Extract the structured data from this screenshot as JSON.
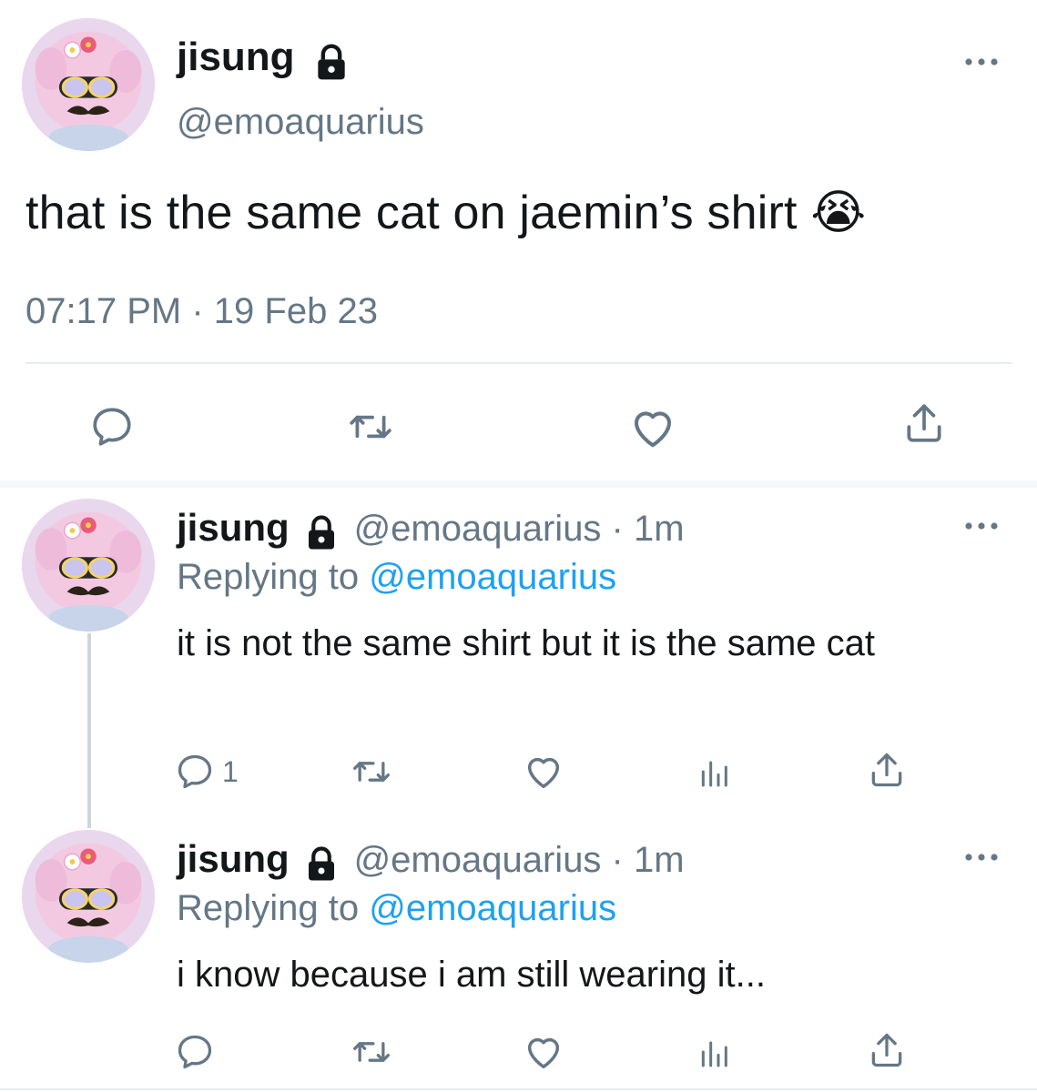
{
  "main_tweet": {
    "display_name": "jisung",
    "handle": "@emoaquarius",
    "text": "that is the same cat on jaemin’s shirt 😭",
    "time": "07:17 PM",
    "separator": "·",
    "date": "19 Feb 23",
    "icons": [
      "lock-icon",
      "more-icon",
      "reply-icon",
      "retweet-icon",
      "like-icon",
      "share-icon"
    ]
  },
  "replies": [
    {
      "display_name": "jisung",
      "meta": "@emoaquarius · 1m",
      "replying_prefix": "Replying to",
      "replying_to": "@emoaquarius",
      "text": "it is not the same shirt but it is the same cat",
      "reply_count": "1"
    },
    {
      "display_name": "jisung",
      "meta": "@emoaquarius · 1m",
      "replying_prefix": "Replying to",
      "replying_to": "@emoaquarius",
      "text": "i know because i am still wearing it...",
      "reply_count": ""
    }
  ],
  "colors": {
    "text": "#14171a",
    "secondary": "#657786",
    "link": "#1da1f2",
    "divider": "#e6ecf0",
    "icon": "#657786"
  }
}
